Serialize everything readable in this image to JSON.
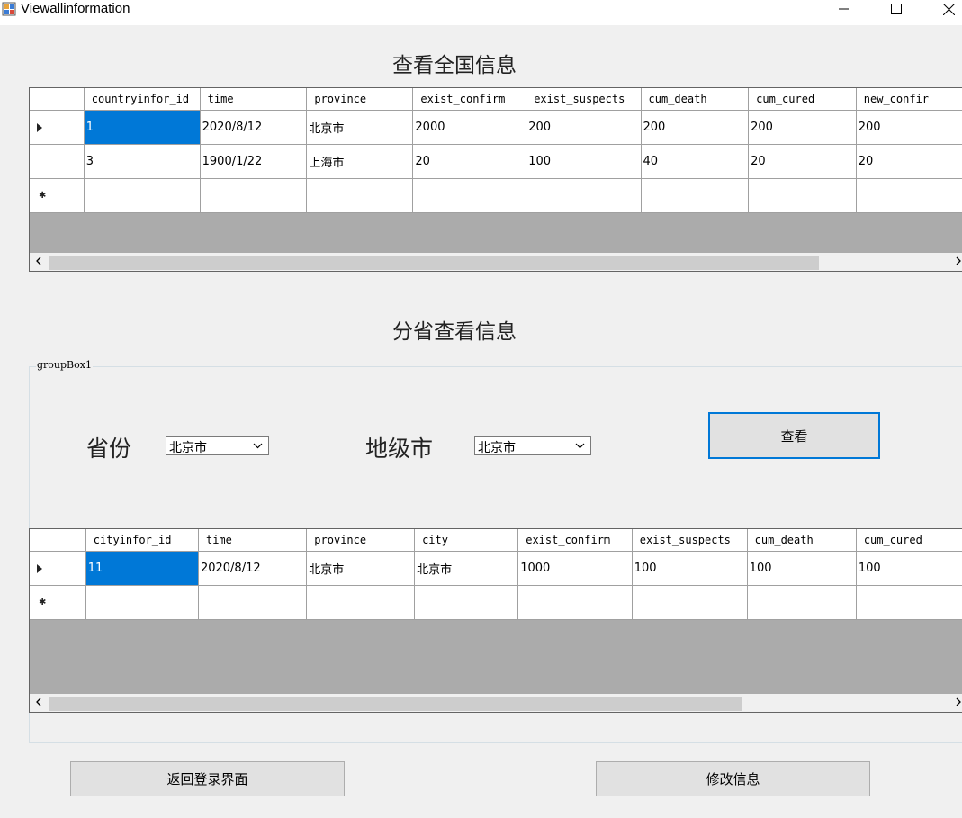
{
  "window": {
    "title": "Viewallinformation",
    "icon": "form-icon",
    "controls": [
      "minimize-icon",
      "maximize-icon",
      "close-icon"
    ]
  },
  "national": {
    "heading": "查看全国信息",
    "columns": [
      "countryinfor_id",
      "time",
      "province",
      "exist_confirm",
      "exist_suspects",
      "cum_death",
      "cum_cured",
      "new_confir"
    ],
    "rows": [
      [
        "1",
        "2020/8/12",
        "北京市",
        "2000",
        "200",
        "200",
        "200",
        "200"
      ],
      [
        "3",
        "1900/1/22",
        "上海市",
        "20",
        "100",
        "40",
        "20",
        "20"
      ]
    ],
    "selected_cell": [
      0,
      0
    ]
  },
  "province_section": {
    "heading": "分省查看信息",
    "group_label": "groupBox1",
    "province_label": "省份",
    "province_value": "北京市",
    "city_label": "地级市",
    "city_value": "北京市",
    "view_button": "查看"
  },
  "city_grid": {
    "columns": [
      "cityinfor_id",
      "time",
      "province",
      "city",
      "exist_confirm",
      "exist_suspects",
      "cum_death",
      "cum_cured"
    ],
    "rows": [
      [
        "11",
        "2020/8/12",
        "北京市",
        "北京市",
        "1000",
        "100",
        "100",
        "100"
      ]
    ],
    "selected_cell": [
      0,
      0
    ]
  },
  "footer": {
    "back_button": "返回登录界面",
    "edit_button": "修改信息"
  },
  "colors": {
    "selection": "#0078d7",
    "grid_background": "#ababab",
    "window_background": "#f0f0f0"
  }
}
